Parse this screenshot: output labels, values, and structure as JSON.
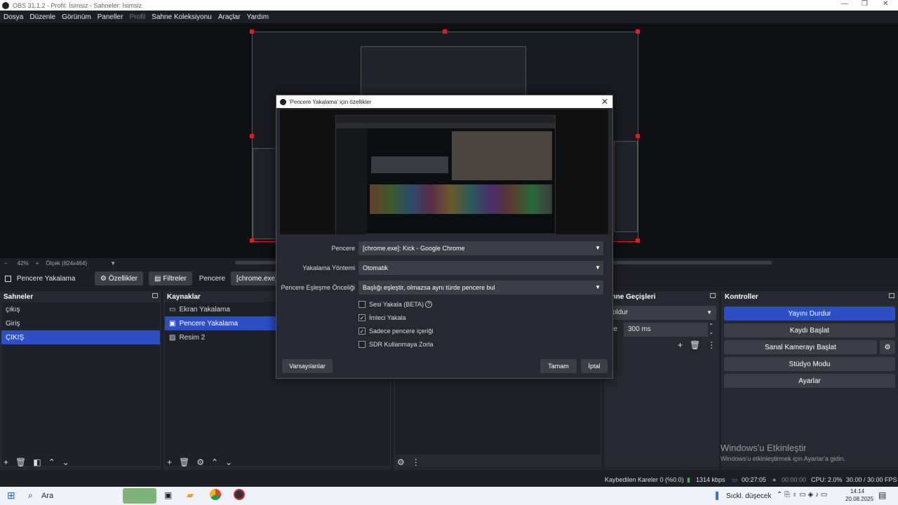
{
  "window": {
    "title": "OBS 31.1.2 - Profil: İsimsiz - Sahneler: İsimsiz"
  },
  "menu": [
    "Dosya",
    "Düzenle",
    "Görünüm",
    "Paneller",
    "Profil",
    "Sahne Koleksiyonu",
    "Araçlar",
    "Yardım"
  ],
  "zoom": {
    "minus": "−",
    "value": "42%",
    "plus": "+",
    "scale_label": "Ölçek (824x464)"
  },
  "source_toolbar": {
    "source_name": "Pencere Yakalama",
    "properties": "Özellikler",
    "filters": "Filtreler",
    "window_label": "Pencere",
    "window_value": "[chrome.exe]: Kic"
  },
  "scenes": {
    "title": "Sahneler",
    "items": [
      {
        "label": "çıkış",
        "selected": false
      },
      {
        "label": "Giriş",
        "selected": false
      },
      {
        "label": "ÇIKIŞ",
        "selected": true
      }
    ]
  },
  "sources": {
    "title": "Kaynaklar",
    "items": [
      {
        "label": "Ekran Yakalama",
        "icon": "monitor-icon",
        "selected": false
      },
      {
        "label": "Pencere Yakalama",
        "icon": "window-icon",
        "selected": true
      },
      {
        "label": "Resim 2",
        "icon": "image-icon",
        "selected": false
      }
    ]
  },
  "transitions": {
    "title": "ahne Geçişleri",
    "fade_label": "oldur",
    "duration_label": "re",
    "duration_value": "300 ms"
  },
  "controls": {
    "title": "Kontroller",
    "stop_stream": "Yayını Durdur",
    "start_record": "Kaydı Başlat",
    "start_vcam": "Sanal Kamerayı Başlat",
    "studio_mode": "Stüdyo Modu",
    "settings": "Ayarlar"
  },
  "activation": {
    "title": "Windows'u Etkinleştir",
    "subtitle": "Windows'u etkinleştirmek için Ayarlar'a gidin."
  },
  "status": {
    "dropped": "Kaybedilen Kareler 0 (%0.0)",
    "bitrate": "1314 kbps",
    "stream_time": "00:27:05",
    "rec_time": "00:00:00",
    "cpu": "CPU: 2.0%",
    "fps": "30.00 / 30.00 FPS"
  },
  "dialog": {
    "title": "'Pencere Yakalama' için özellikler",
    "window_label": "Pencere",
    "window_value": "[chrome.exe]: Kick - Google Chrome",
    "method_label": "Yakalama Yöntemi",
    "method_value": "Otomatik",
    "priority_label": "Pencere Eşleşme Önceliği",
    "priority_value": "Başlığı eşleştir, olmazsa aynı türde pencere bul",
    "checkboxes": [
      {
        "label": "Sesi Yakala (BETA)",
        "checked": false
      },
      {
        "label": "İmleci Yakala",
        "checked": true
      },
      {
        "label": "Sadece pencere içeriği",
        "checked": true
      },
      {
        "label": "SDR Kullanmaya Zorla",
        "checked": false
      }
    ],
    "defaults_button": "Varsayılanlar",
    "ok_button": "Tamam",
    "cancel_button": "İptal"
  },
  "taskbar": {
    "search": "Ara",
    "weather": "Sıckl. düşecek",
    "time": "14:14",
    "date": "20.08.2025"
  }
}
